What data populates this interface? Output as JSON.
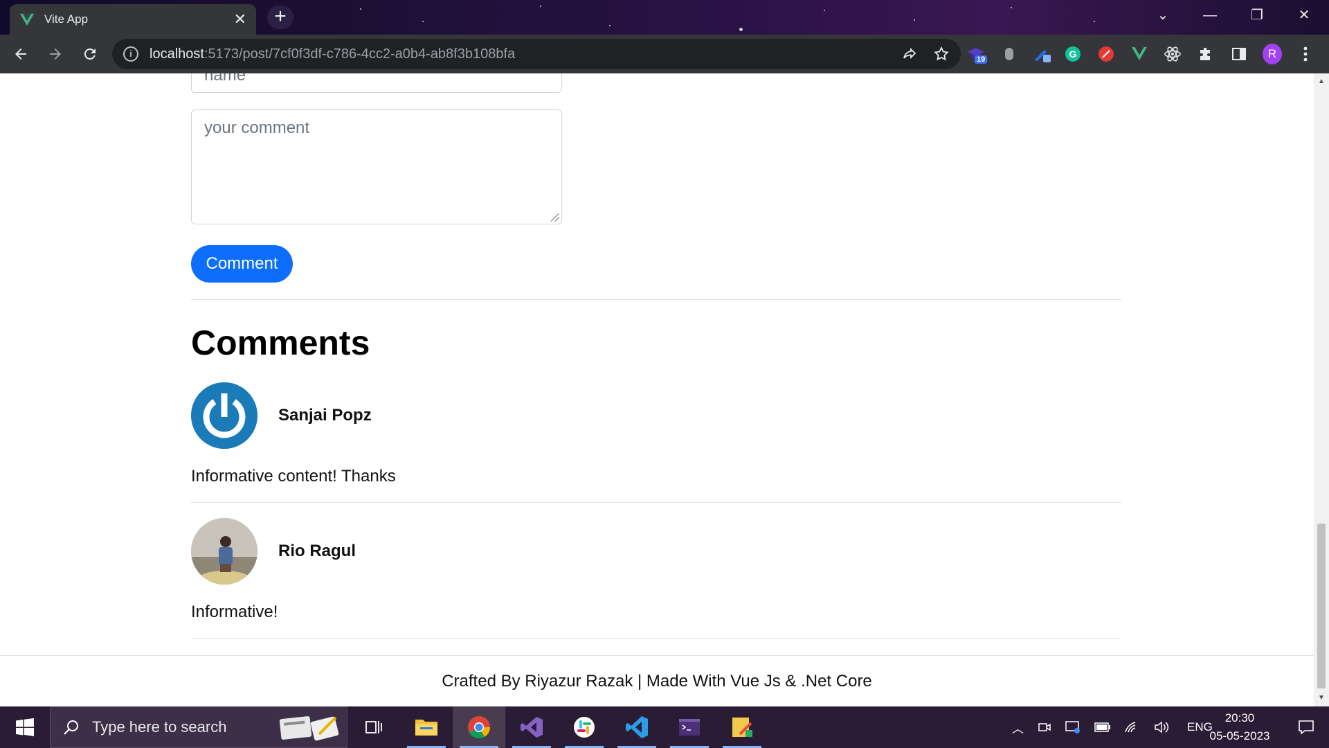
{
  "browser": {
    "tab_title": "Vite App",
    "url_host": "localhost",
    "url_path": ":5173/post/7cf0f3df-c786-4cc2-a0b4-ab8f3b108bfa",
    "extension_badge": "19",
    "profile_initial": "R"
  },
  "form": {
    "name_placeholder": "name",
    "comment_placeholder": "your comment",
    "submit_label": "Comment"
  },
  "comments": {
    "heading": "Comments",
    "items": [
      {
        "author": "Sanjai Popz",
        "text": "Informative content! Thanks"
      },
      {
        "author": "Rio Ragul",
        "text": "Informative!"
      }
    ]
  },
  "footer": {
    "text": "Crafted By Riyazur Razak | Made With Vue Js & .Net Core"
  },
  "taskbar": {
    "search_placeholder": "Type here to search",
    "language": "ENG",
    "time": "20:30",
    "date": "05-05-2023"
  },
  "colors": {
    "primary": "#0d6efd",
    "chrome_bg": "#35363a",
    "vue_green": "#42b883"
  }
}
